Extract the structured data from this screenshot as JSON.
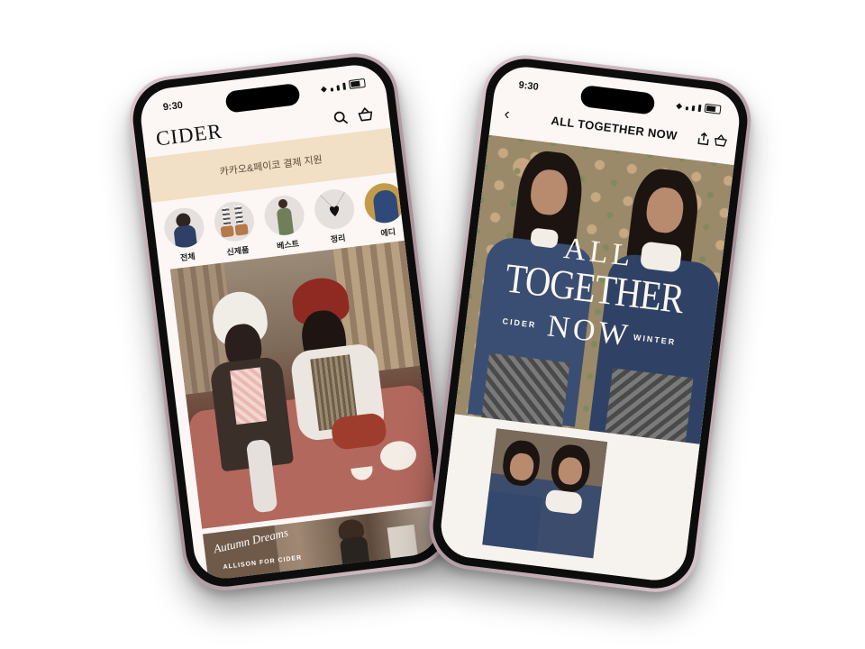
{
  "left_phone": {
    "status_time": "9:30",
    "logo": "CIDER",
    "promo_banner": "카카오&페이코 결제 지원",
    "categories": [
      {
        "label": "전체"
      },
      {
        "label": "신제품"
      },
      {
        "label": "베스트"
      },
      {
        "label": "정리"
      },
      {
        "label": "에디"
      }
    ],
    "bottom_banner": {
      "title": "Autumn Dreams",
      "subtitle": "ALLISON FOR CIDER"
    },
    "icons": [
      "search-icon",
      "basket-icon"
    ]
  },
  "right_phone": {
    "status_time": "9:30",
    "header_title": "ALL TOGETHER NOW",
    "campaign": {
      "line1": "ALL",
      "line2": "TOGETHER",
      "line3": "NOW",
      "left_word": "CIDER",
      "right_word": "WINTER"
    },
    "icons": [
      "back-icon",
      "share-icon",
      "basket-icon"
    ]
  },
  "colors": {
    "frame": "#b89ea6",
    "screen_bg": "#fcf7f5",
    "promo_bg": "#f1dfc6",
    "campaign_text": "#fdf8ef"
  }
}
